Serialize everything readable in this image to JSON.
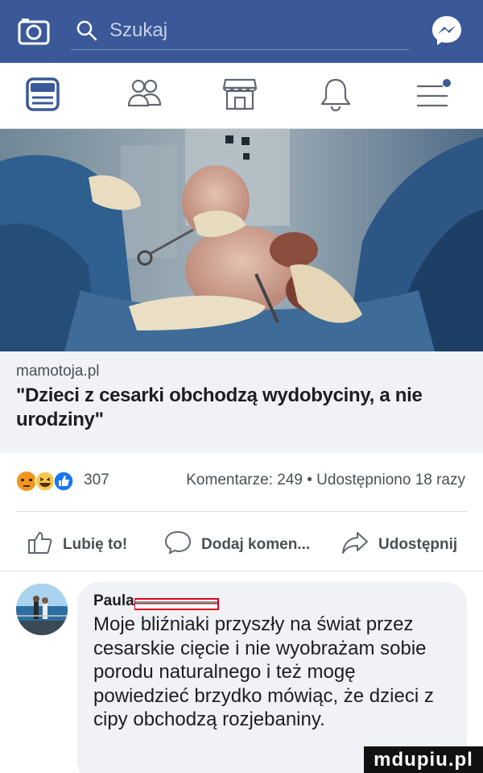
{
  "topbar": {
    "search_placeholder": "Szukaj",
    "bg_color": "#3b5998"
  },
  "nav": {
    "items": [
      {
        "icon": "news-feed-icon"
      },
      {
        "icon": "friends-icon"
      },
      {
        "icon": "marketplace-icon"
      },
      {
        "icon": "bell-icon"
      },
      {
        "icon": "menu-icon",
        "has_dot": true
      }
    ]
  },
  "post": {
    "domain": "mamotoja.pl",
    "title": "\"Dzieci z cesarki obchodzą wydobyciny, a nie urodziny\"",
    "reaction_icons": [
      "angry-icon",
      "haha-icon",
      "like-icon"
    ],
    "reaction_count": "307",
    "stats": "Komentarze: 249 • Udostępniono 18 razy"
  },
  "actions": {
    "like": "Lubię to!",
    "comment": "Dodaj komen...",
    "share": "Udostępnij"
  },
  "comment": {
    "author": "Paula",
    "text": "Moje bliźniaki przyszły na świat przez cesarskie cięcie i nie wyobrażam sobie porodu naturalnego i też mogę powiedzieć brzydko mówiąc, że dzieci z cipy obchodzą rozjebaniny."
  },
  "watermark": {
    "text": "mdupiu.pl"
  }
}
